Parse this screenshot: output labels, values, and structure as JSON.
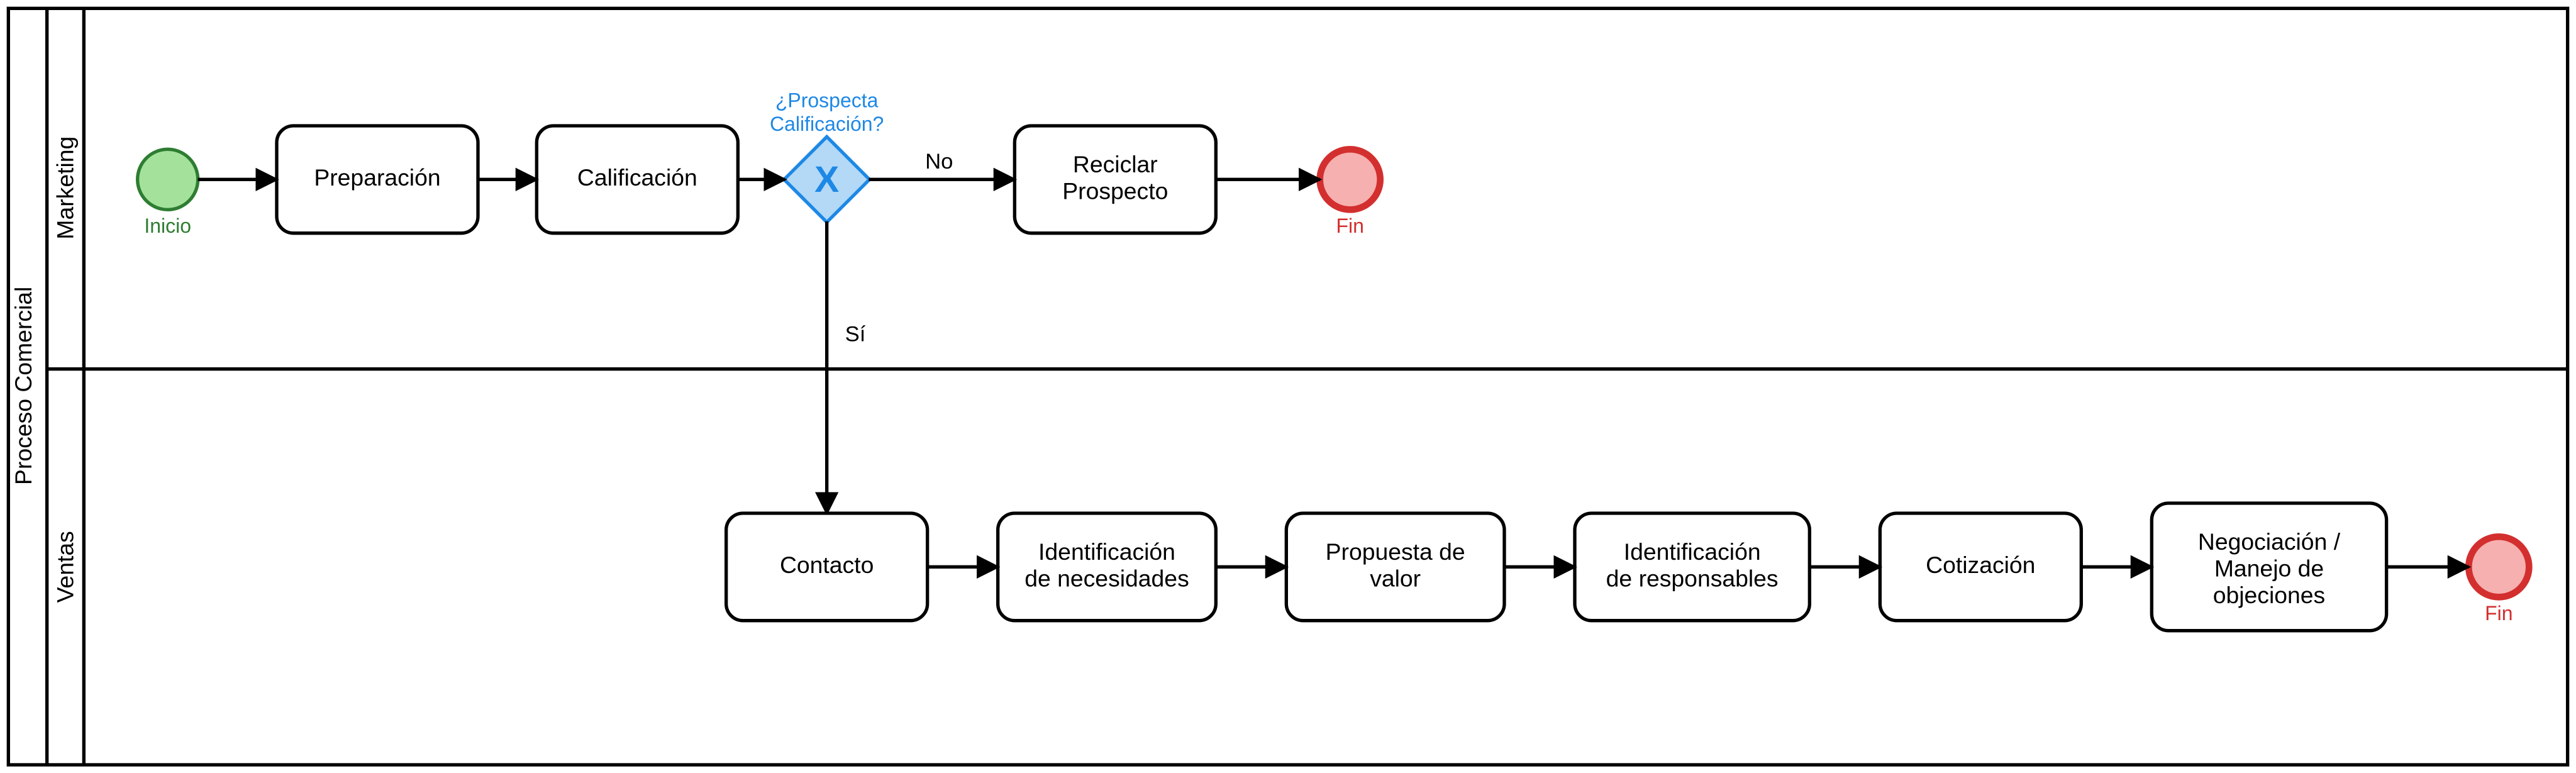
{
  "pool": {
    "title": "Proceso Comercial"
  },
  "lanes": {
    "marketing": {
      "title": "Marketing"
    },
    "ventas": {
      "title": "Ventas"
    }
  },
  "events": {
    "start": {
      "label": "Inicio",
      "color_label": "#2e7d32"
    },
    "end_mkt": {
      "label": "Fin",
      "color_label": "#d32f2f"
    },
    "end_sales": {
      "label": "Fin",
      "color_label": "#d32f2f"
    }
  },
  "gateway": {
    "label_line1": "¿Prospecta",
    "label_line2": "Calificación?",
    "marker": "X",
    "out_no": "No",
    "out_yes": "Sí"
  },
  "tasks": {
    "preparacion": {
      "label": "Preparación"
    },
    "calificacion": {
      "label": "Calificación"
    },
    "reciclar_l1": "Reciclar",
    "reciclar_l2": "Prospecto",
    "contacto": {
      "label": "Contacto"
    },
    "ident_nec_l1": "Identificación",
    "ident_nec_l2": "de necesidades",
    "propuesta_l1": "Propuesta de",
    "propuesta_l2": "valor",
    "ident_resp_l1": "Identificación",
    "ident_resp_l2": "de responsables",
    "cotizacion": {
      "label": "Cotización"
    },
    "negociacion_l1": "Negociación /",
    "negociacion_l2": "Manejo de",
    "negociacion_l3": "objeciones"
  }
}
